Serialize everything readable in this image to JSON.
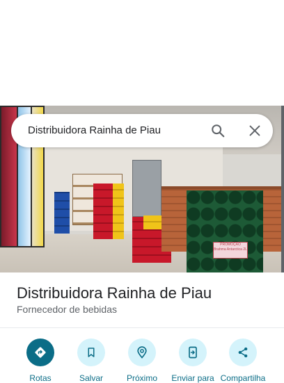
{
  "search": {
    "query": "Distribuidora Rainha de Piau"
  },
  "photo": {
    "poster_text": "PROMOÇÃO Brahma Antarctica 2L"
  },
  "place": {
    "name": "Distribuidora Rainha de Piau",
    "category": "Fornecedor de bebidas"
  },
  "actions": [
    {
      "label": "Rotas",
      "icon": "directions-icon"
    },
    {
      "label": "Salvar",
      "icon": "bookmark-icon"
    },
    {
      "label": "Próximo",
      "icon": "nearby-icon"
    },
    {
      "label": "Enviar para",
      "icon": "send-to-phone-icon"
    },
    {
      "label": "Compartilha",
      "icon": "share-icon"
    }
  ],
  "colors": {
    "accent": "#0b6d87",
    "action_bg": "#d4f3fb",
    "title_text": "#202124",
    "secondary_text": "#5f6368"
  }
}
